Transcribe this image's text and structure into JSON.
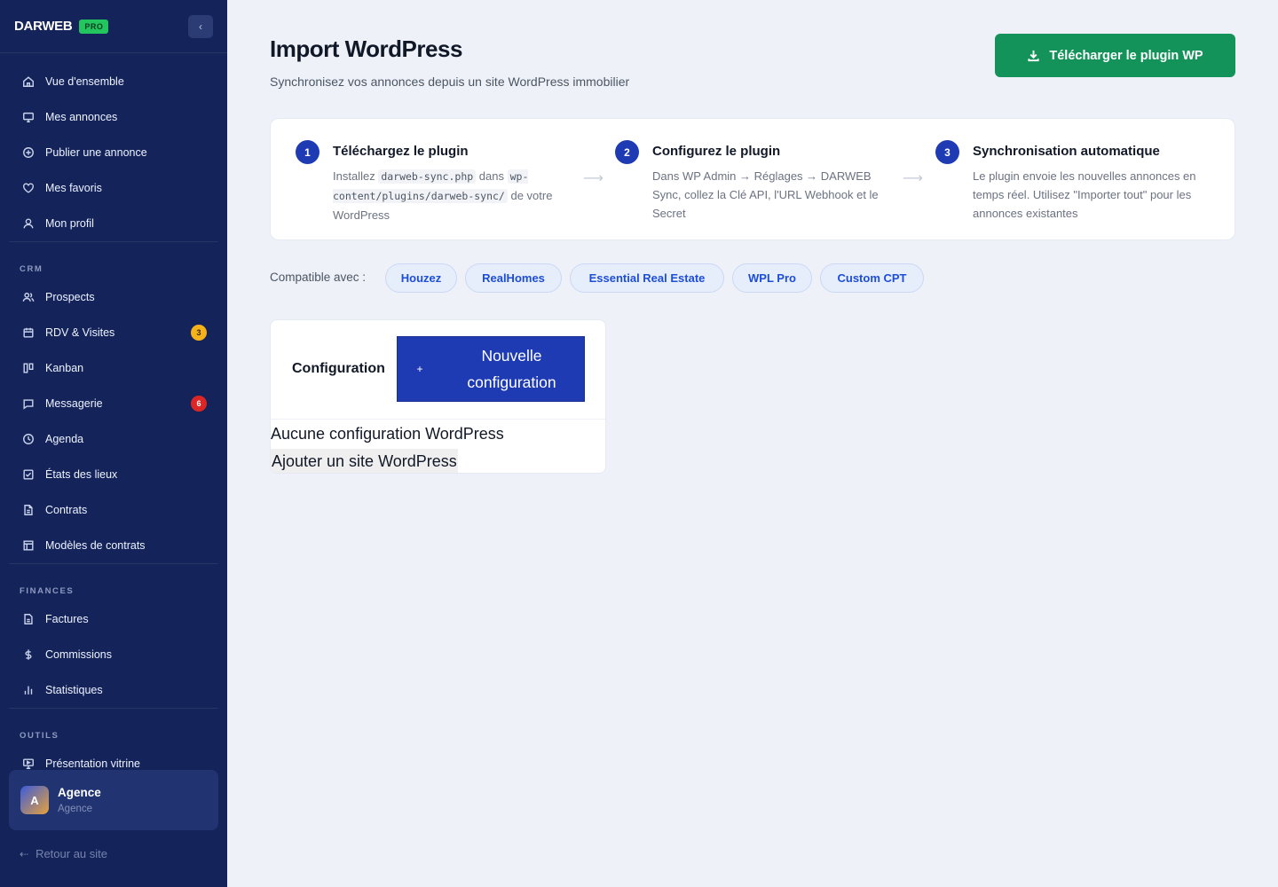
{
  "sidebar": {
    "brand": "DARWEB",
    "badge": "PRO",
    "collapse_icon": "chevron-left-icon",
    "items_main": [
      {
        "label": "Vue d'ensemble",
        "icon": "home-icon"
      },
      {
        "label": "Mes annonces",
        "icon": "monitor-icon"
      },
      {
        "label": "Publier une annonce",
        "icon": "plus-circle-icon"
      },
      {
        "label": "Mes favoris",
        "icon": "heart-icon"
      },
      {
        "label": "Mon profil",
        "icon": "user-icon"
      }
    ],
    "sections": {
      "crm": "CRM",
      "finances": "FINANCES",
      "outils": "OUTILS"
    },
    "items_crm": [
      {
        "label": "Prospects",
        "icon": "users-icon"
      },
      {
        "label": "RDV & Visites",
        "icon": "calendar-icon",
        "badge": "3"
      },
      {
        "label": "Kanban",
        "icon": "kanban-icon"
      },
      {
        "label": "Messagerie",
        "icon": "message-icon",
        "badge": "6"
      },
      {
        "label": "Agenda",
        "icon": "clock-icon"
      },
      {
        "label": "États des lieux",
        "icon": "checklist-icon"
      },
      {
        "label": "Contrats",
        "icon": "document-icon"
      },
      {
        "label": "Modèles de contrats",
        "icon": "template-icon"
      }
    ],
    "items_finances": [
      {
        "label": "Factures",
        "icon": "invoice-icon"
      },
      {
        "label": "Commissions",
        "icon": "dollar-icon"
      },
      {
        "label": "Statistiques",
        "icon": "bar-chart-icon"
      }
    ],
    "items_outils": [
      {
        "label": "Présentation vitrine",
        "icon": "presentation-icon"
      }
    ],
    "user": {
      "initial": "A",
      "name": "Agence",
      "role": "Agence"
    },
    "back_link": "Retour au site"
  },
  "header": {
    "title": "Import WordPress",
    "subtitle": "Synchronisez vos annonces depuis un site WordPress immobilier",
    "download_button": "Télécharger le plugin WP"
  },
  "steps": [
    {
      "num": "1",
      "title": "Téléchargez le plugin",
      "desc_pre": "Installez ",
      "code1": "darweb-sync.php",
      "desc_mid": " dans ",
      "code2": "wp-content/plugins/darweb-sync/",
      "desc_post": " de votre WordPress"
    },
    {
      "num": "2",
      "title": "Configurez le plugin",
      "desc": "Dans WP Admin → Réglages → DARWEB Sync, collez la Clé API, l'URL Webhook et le Secret"
    },
    {
      "num": "3",
      "title": "Synchronisation automatique",
      "desc": "Le plugin envoie les nouvelles annonces en temps réel. Utilisez \"Importer tout\" pour les annonces existantes"
    }
  ],
  "step_arrow": "⟶",
  "compat": {
    "label": "Compatible avec :",
    "chips": [
      "Houzez",
      "RealHomes",
      "Essential Real Estate",
      "WPL Pro",
      "Custom CPT"
    ]
  },
  "config": {
    "title": "Configuration",
    "new_button_plus": "+",
    "new_button": "Nouvelle configuration",
    "empty_text": "Aucune configuration WordPress",
    "add_site": "Ajouter un site WordPress"
  }
}
